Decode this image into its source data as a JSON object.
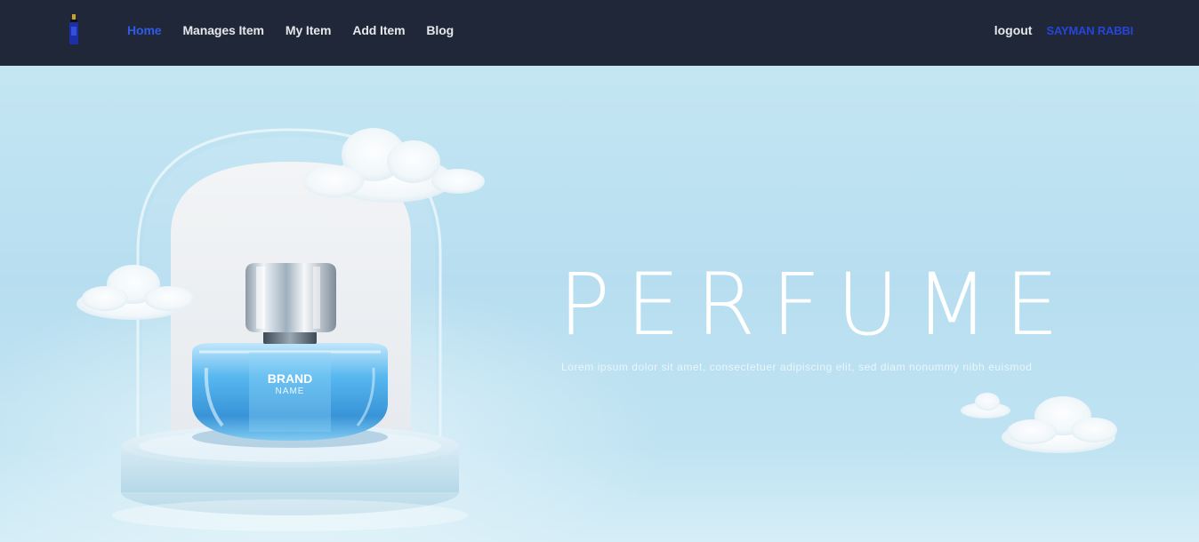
{
  "nav": {
    "logo_icon": "perfume-bottle-logo",
    "links": [
      {
        "label": "Home",
        "active": true
      },
      {
        "label": "Manages Item",
        "active": false
      },
      {
        "label": "My Item",
        "active": false
      },
      {
        "label": "Add Item",
        "active": false
      },
      {
        "label": "Blog",
        "active": false
      }
    ],
    "logout_label": "logout",
    "username": "SAYMAN RABBI"
  },
  "hero": {
    "title": "PERFUME",
    "subtitle": "Lorem ipsum dolor sit amet, consectetuer adipiscing elit, sed diam nonummy nibh euismod",
    "bottle_brand": "BRAND",
    "bottle_name": "NAME"
  },
  "colors": {
    "navbar_bg": "#1f2738",
    "active_link": "#2f5be6",
    "username": "#2646d8",
    "hero_sky": "#b7def0"
  }
}
